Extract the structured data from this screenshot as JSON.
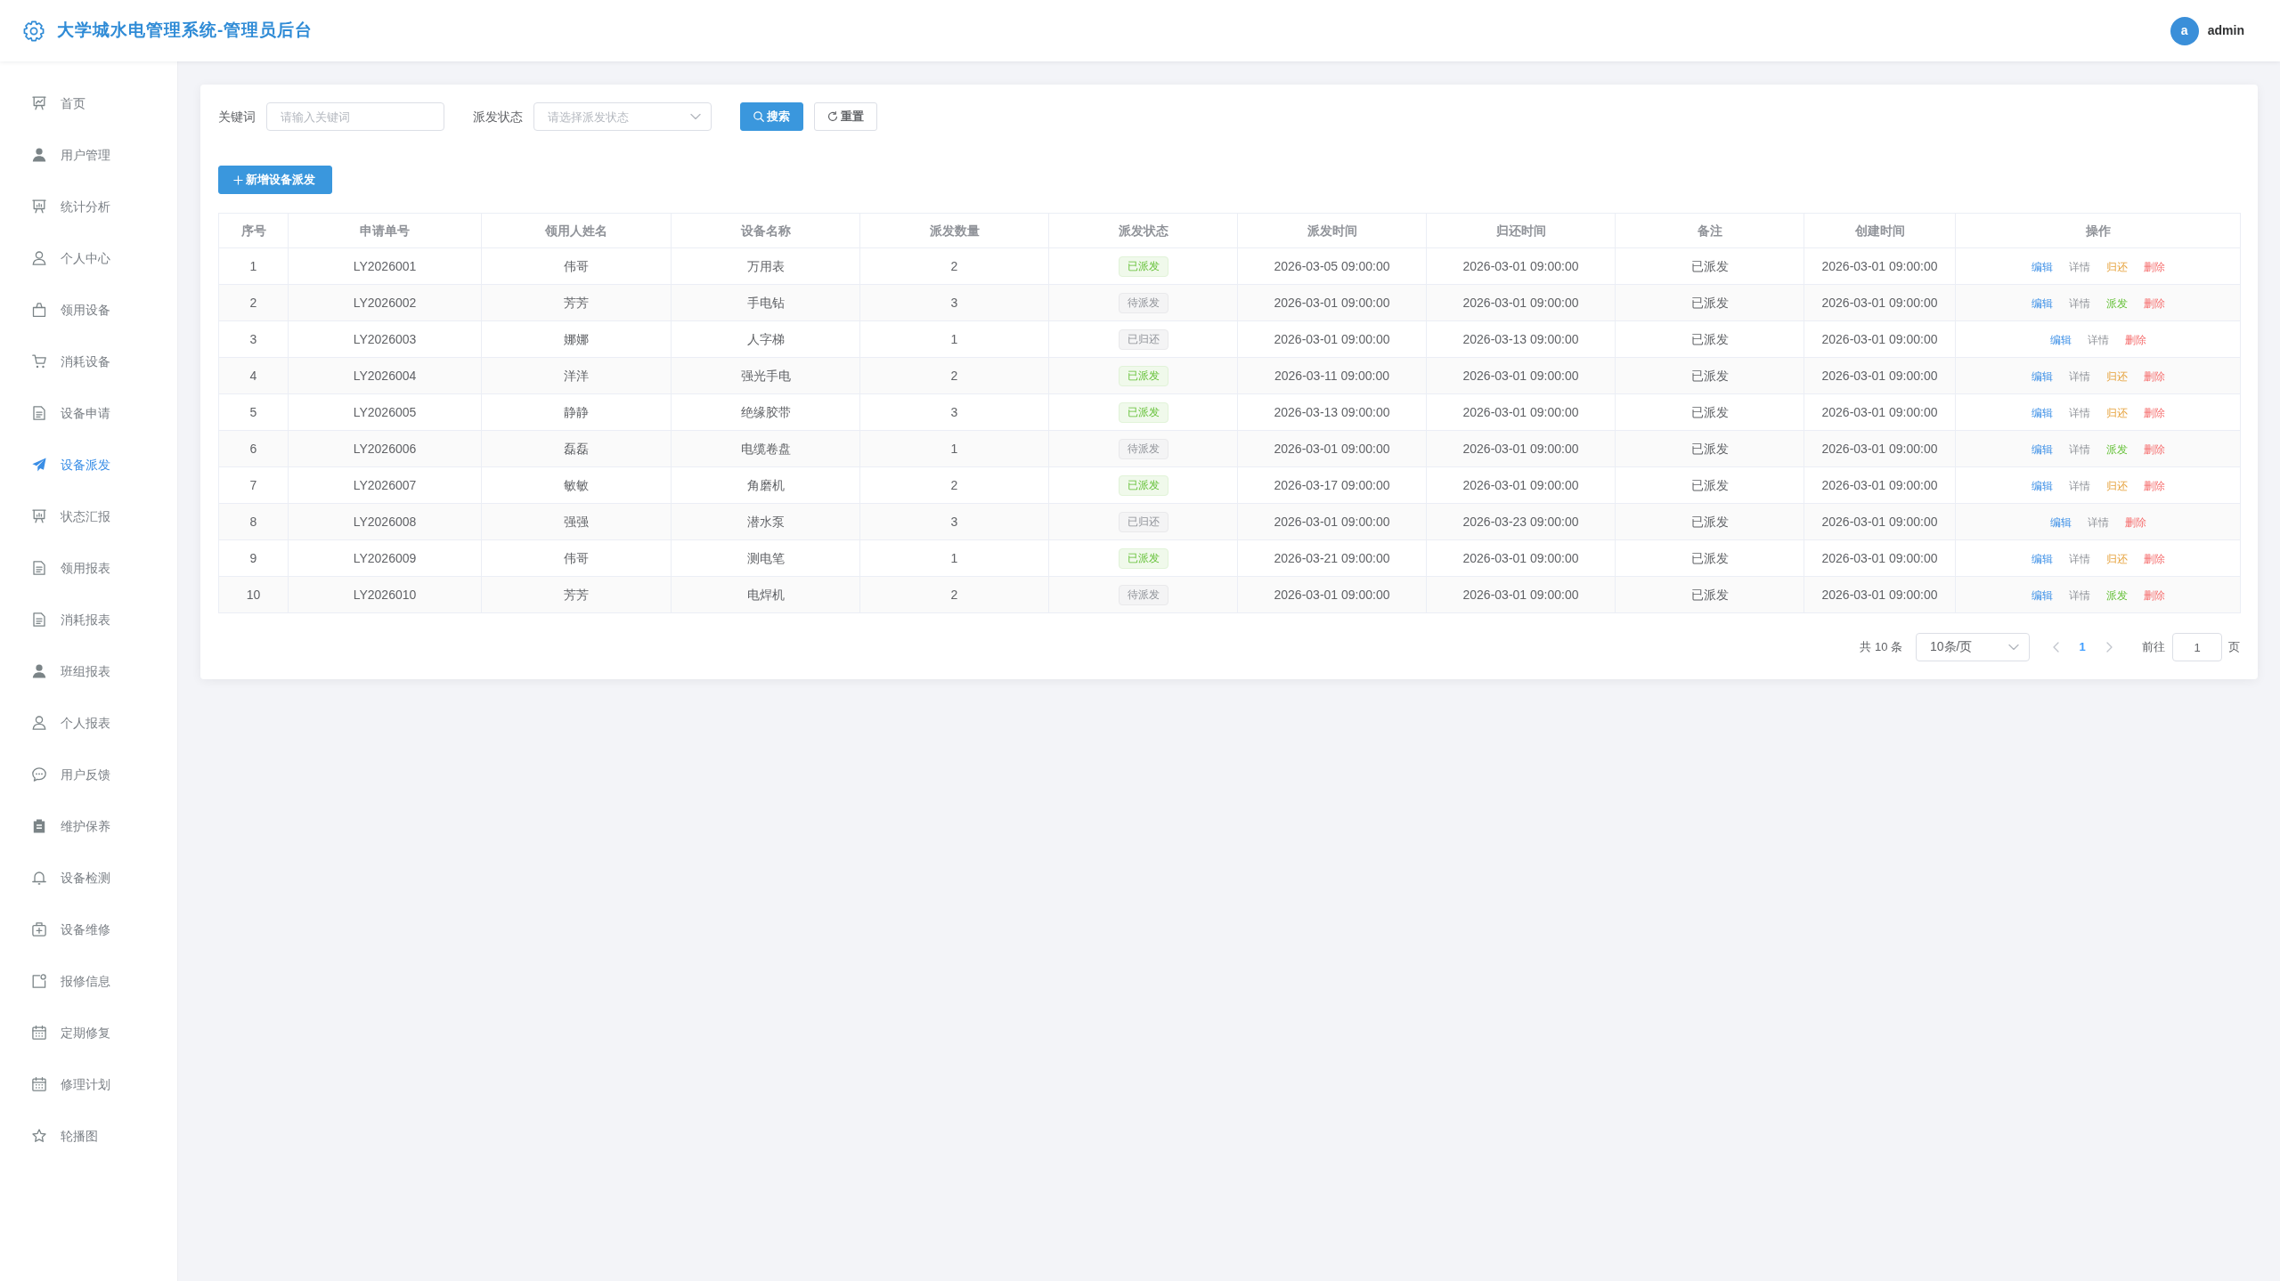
{
  "header": {
    "title": "大学城水电管理系统-管理员后台",
    "avatar_letter": "a",
    "username": "admin"
  },
  "sidebar": {
    "items": [
      {
        "label": "首页",
        "selected": false
      },
      {
        "label": "用户管理",
        "selected": false
      },
      {
        "label": "统计分析",
        "selected": false
      },
      {
        "label": "个人中心",
        "selected": false
      },
      {
        "label": "领用设备",
        "selected": false
      },
      {
        "label": "消耗设备",
        "selected": false
      },
      {
        "label": "设备申请",
        "selected": false
      },
      {
        "label": "设备派发",
        "selected": true
      },
      {
        "label": "状态汇报",
        "selected": false
      },
      {
        "label": "领用报表",
        "selected": false
      },
      {
        "label": "消耗报表",
        "selected": false
      },
      {
        "label": "班组报表",
        "selected": false
      },
      {
        "label": "个人报表",
        "selected": false
      },
      {
        "label": "用户反馈",
        "selected": false
      },
      {
        "label": "维护保养",
        "selected": false
      },
      {
        "label": "设备检测",
        "selected": false
      },
      {
        "label": "设备维修",
        "selected": false
      },
      {
        "label": "报修信息",
        "selected": false
      },
      {
        "label": "定期修复",
        "selected": false
      },
      {
        "label": "修理计划",
        "selected": false
      },
      {
        "label": "轮播图",
        "selected": false
      }
    ]
  },
  "filters": {
    "keyword": {
      "label": "关键词",
      "placeholder": "请输入关键词"
    },
    "status": {
      "label": "派发状态",
      "placeholder": "请选择派发状态"
    },
    "buttons": [
      {
        "label": "搜索",
        "kind": "search"
      },
      {
        "label": "重置",
        "kind": "reset"
      }
    ]
  },
  "add_button": {
    "label": "新增设备派发"
  },
  "table": {
    "columns": [
      "序号",
      "申请单号",
      "领用人姓名",
      "设备名称",
      "派发数量",
      "派发状态",
      "派发时间",
      "归还时间",
      "备注",
      "创建时间",
      "操作"
    ],
    "rows": [
      {
        "no": "1",
        "order_no": "LY2026001",
        "recipient": "伟哥",
        "device": "万用表",
        "quantity": "2",
        "status": {
          "label": "已派发",
          "kind": "dispatched"
        },
        "dispatch_time": "2026-03-05 09:00:00",
        "return_time": "2026-03-01 09:00:00",
        "remark": "已派发",
        "created_time": "2026-03-01 09:00:00",
        "actions": [
          {
            "label": "编辑",
            "kind": "edit"
          },
          {
            "label": "详情",
            "kind": "detail"
          },
          {
            "label": "归还",
            "kind": "return"
          },
          {
            "label": "删除",
            "kind": "delete"
          }
        ]
      },
      {
        "no": "2",
        "order_no": "LY2026002",
        "recipient": "芳芳",
        "device": "手电钻",
        "quantity": "3",
        "status": {
          "label": "待派发",
          "kind": "pending"
        },
        "dispatch_time": "2026-03-01 09:00:00",
        "return_time": "2026-03-01 09:00:00",
        "remark": "已派发",
        "created_time": "2026-03-01 09:00:00",
        "actions": [
          {
            "label": "编辑",
            "kind": "edit"
          },
          {
            "label": "详情",
            "kind": "detail"
          },
          {
            "label": "派发",
            "kind": "dispatch"
          },
          {
            "label": "删除",
            "kind": "delete"
          }
        ]
      },
      {
        "no": "3",
        "order_no": "LY2026003",
        "recipient": "娜娜",
        "device": "人字梯",
        "quantity": "1",
        "status": {
          "label": "已归还",
          "kind": "returned"
        },
        "dispatch_time": "2026-03-01 09:00:00",
        "return_time": "2026-03-13 09:00:00",
        "remark": "已派发",
        "created_time": "2026-03-01 09:00:00",
        "actions": [
          {
            "label": "编辑",
            "kind": "edit"
          },
          {
            "label": "详情",
            "kind": "detail"
          },
          {
            "label": "删除",
            "kind": "delete"
          }
        ]
      },
      {
        "no": "4",
        "order_no": "LY2026004",
        "recipient": "洋洋",
        "device": "强光手电",
        "quantity": "2",
        "status": {
          "label": "已派发",
          "kind": "dispatched"
        },
        "dispatch_time": "2026-03-11 09:00:00",
        "return_time": "2026-03-01 09:00:00",
        "remark": "已派发",
        "created_time": "2026-03-01 09:00:00",
        "actions": [
          {
            "label": "编辑",
            "kind": "edit"
          },
          {
            "label": "详情",
            "kind": "detail"
          },
          {
            "label": "归还",
            "kind": "return"
          },
          {
            "label": "删除",
            "kind": "delete"
          }
        ]
      },
      {
        "no": "5",
        "order_no": "LY2026005",
        "recipient": "静静",
        "device": "绝缘胶带",
        "quantity": "3",
        "status": {
          "label": "已派发",
          "kind": "dispatched"
        },
        "dispatch_time": "2026-03-13 09:00:00",
        "return_time": "2026-03-01 09:00:00",
        "remark": "已派发",
        "created_time": "2026-03-01 09:00:00",
        "actions": [
          {
            "label": "编辑",
            "kind": "edit"
          },
          {
            "label": "详情",
            "kind": "detail"
          },
          {
            "label": "归还",
            "kind": "return"
          },
          {
            "label": "删除",
            "kind": "delete"
          }
        ]
      },
      {
        "no": "6",
        "order_no": "LY2026006",
        "recipient": "磊磊",
        "device": "电缆卷盘",
        "quantity": "1",
        "status": {
          "label": "待派发",
          "kind": "pending"
        },
        "dispatch_time": "2026-03-01 09:00:00",
        "return_time": "2026-03-01 09:00:00",
        "remark": "已派发",
        "created_time": "2026-03-01 09:00:00",
        "actions": [
          {
            "label": "编辑",
            "kind": "edit"
          },
          {
            "label": "详情",
            "kind": "detail"
          },
          {
            "label": "派发",
            "kind": "dispatch"
          },
          {
            "label": "删除",
            "kind": "delete"
          }
        ]
      },
      {
        "no": "7",
        "order_no": "LY2026007",
        "recipient": "敏敏",
        "device": "角磨机",
        "quantity": "2",
        "status": {
          "label": "已派发",
          "kind": "dispatched"
        },
        "dispatch_time": "2026-03-17 09:00:00",
        "return_time": "2026-03-01 09:00:00",
        "remark": "已派发",
        "created_time": "2026-03-01 09:00:00",
        "actions": [
          {
            "label": "编辑",
            "kind": "edit"
          },
          {
            "label": "详情",
            "kind": "detail"
          },
          {
            "label": "归还",
            "kind": "return"
          },
          {
            "label": "删除",
            "kind": "delete"
          }
        ]
      },
      {
        "no": "8",
        "order_no": "LY2026008",
        "recipient": "强强",
        "device": "潜水泵",
        "quantity": "3",
        "status": {
          "label": "已归还",
          "kind": "returned"
        },
        "dispatch_time": "2026-03-01 09:00:00",
        "return_time": "2026-03-23 09:00:00",
        "remark": "已派发",
        "created_time": "2026-03-01 09:00:00",
        "actions": [
          {
            "label": "编辑",
            "kind": "edit"
          },
          {
            "label": "详情",
            "kind": "detail"
          },
          {
            "label": "删除",
            "kind": "delete"
          }
        ]
      },
      {
        "no": "9",
        "order_no": "LY2026009",
        "recipient": "伟哥",
        "device": "测电笔",
        "quantity": "1",
        "status": {
          "label": "已派发",
          "kind": "dispatched"
        },
        "dispatch_time": "2026-03-21 09:00:00",
        "return_time": "2026-03-01 09:00:00",
        "remark": "已派发",
        "created_time": "2026-03-01 09:00:00",
        "actions": [
          {
            "label": "编辑",
            "kind": "edit"
          },
          {
            "label": "详情",
            "kind": "detail"
          },
          {
            "label": "归还",
            "kind": "return"
          },
          {
            "label": "删除",
            "kind": "delete"
          }
        ]
      },
      {
        "no": "10",
        "order_no": "LY2026010",
        "recipient": "芳芳",
        "device": "电焊机",
        "quantity": "2",
        "status": {
          "label": "待派发",
          "kind": "pending"
        },
        "dispatch_time": "2026-03-01 09:00:00",
        "return_time": "2026-03-01 09:00:00",
        "remark": "已派发",
        "created_time": "2026-03-01 09:00:00",
        "actions": [
          {
            "label": "编辑",
            "kind": "edit"
          },
          {
            "label": "详情",
            "kind": "detail"
          },
          {
            "label": "派发",
            "kind": "dispatch"
          },
          {
            "label": "删除",
            "kind": "delete"
          }
        ]
      }
    ]
  },
  "pagination": {
    "total": "共 10 条",
    "page_size": "10条/页",
    "previous": {
      "disabled": true
    },
    "pages": [
      {
        "label": "1",
        "selected": true
      }
    ],
    "next": {
      "disabled": true
    },
    "goto_label": "前往",
    "goto_value": "1",
    "goto_suffix": "页"
  }
}
